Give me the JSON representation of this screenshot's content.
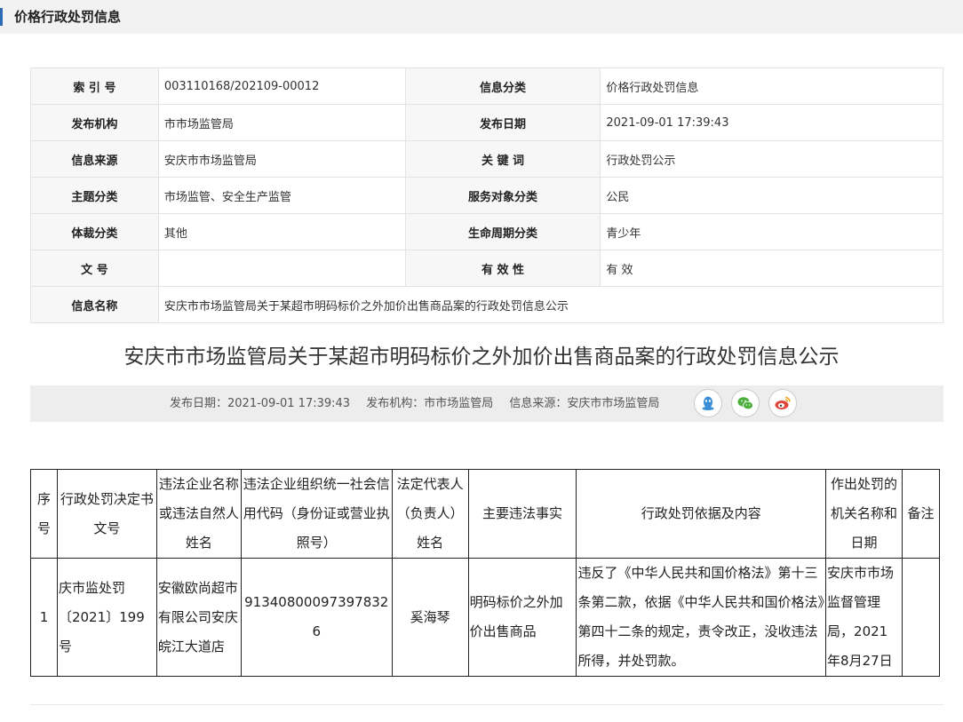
{
  "header": {
    "title": "价格行政处罚信息"
  },
  "meta": {
    "rows": [
      {
        "k1": "索 引 号",
        "v1": "003110168/202109-00012",
        "k2": "信息分类",
        "v2": "价格行政处罚信息"
      },
      {
        "k1": "发布机构",
        "v1": "市市场监管局",
        "k2": "发布日期",
        "v2": "2021-09-01 17:39:43"
      },
      {
        "k1": "信息来源",
        "v1": "安庆市市场监管局",
        "k2": "关 键 词",
        "v2": "行政处罚公示"
      },
      {
        "k1": "主题分类",
        "v1": "市场监管、安全生产监管",
        "k2": "服务对象分类",
        "v2": "公民"
      },
      {
        "k1": "体裁分类",
        "v1": "其他",
        "k2": "生命周期分类",
        "v2": "青少年"
      },
      {
        "k1": "文 号",
        "v1": "",
        "k2": "有 效 性",
        "v2": "有 效"
      }
    ],
    "name_key": "信息名称",
    "name_value": "安庆市市场监管局关于某超市明码标价之外加价出售商品案的行政处罚信息公示"
  },
  "article": {
    "title": "安庆市市场监管局关于某超市明码标价之外加价出售商品案的行政处罚信息公示",
    "publish_date": "发布日期：2021-09-01 17:39:43",
    "publisher": "发布机构：市市场监管局",
    "source": "信息来源：安庆市市场监管局"
  },
  "share": [
    {
      "icon": "qq-icon",
      "color": "#3b8ed8"
    },
    {
      "icon": "wechat-icon",
      "color": "#4caf3c"
    },
    {
      "icon": "weibo-icon",
      "color": "#e0473c"
    }
  ],
  "penalty_table": {
    "headers": [
      "序号",
      "行政处罚决定书文号",
      "违法企业名称或违法自然人姓名",
      "违法企业组织统一社会信用代码（身份证或营业执照号）",
      "法定代表人（负责人）姓名",
      "主要违法事实",
      "行政处罚依据及内容",
      "作出处罚的机关名称和日期",
      "备注"
    ],
    "row": {
      "no": "1",
      "doc_no": "庆市监处罚〔2021〕199号",
      "name": "安徽欧尚超市有限公司安庆皖江大道店",
      "credit_code": "91340800097397832​6",
      "legal_rep": "奚海琴",
      "facts": "明码标价之外加价出售商品",
      "basis": "违反了《中华人民共和国价格法》第十三条第二款，依据《中华人民共和国价格法》第四十二条的规定，责令改正，没收违法所得，并处罚款。",
      "authority": "安庆市市场监督管理局，2021年8月27日",
      "remark": ""
    }
  }
}
